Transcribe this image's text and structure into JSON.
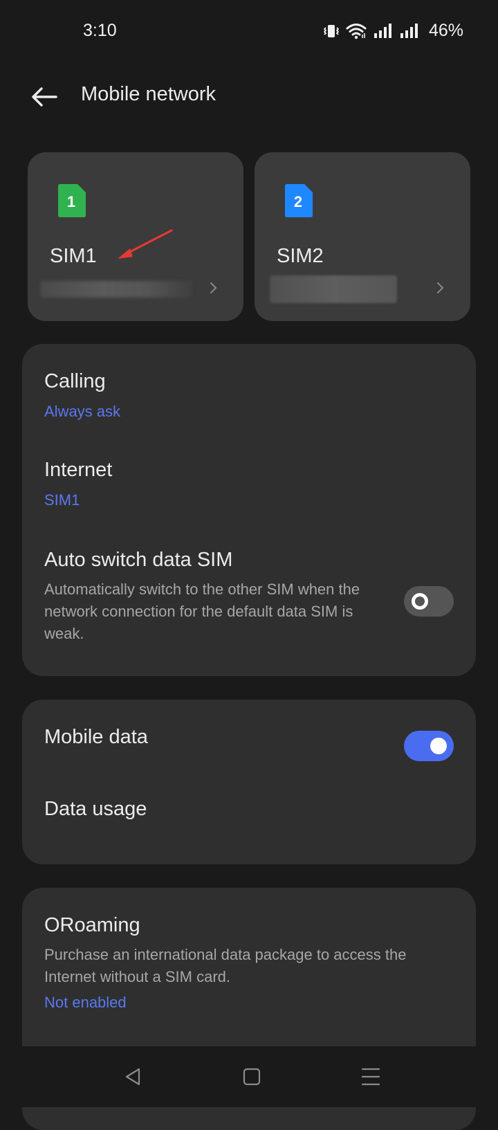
{
  "status_bar": {
    "time": "3:10",
    "battery": "46%",
    "icons": [
      "vibrate-icon",
      "wifi-icon",
      "signal-sim1-icon",
      "signal-sim2-icon"
    ]
  },
  "app_bar": {
    "title": "Mobile network",
    "back_icon": "back-arrow-icon"
  },
  "sim_cards": [
    {
      "badge": "1",
      "name": "SIM1",
      "badge_color": "#2fb24f"
    },
    {
      "badge": "2",
      "name": "SIM2",
      "badge_color": "#1e88ff"
    }
  ],
  "group1": {
    "calling": {
      "title": "Calling",
      "value": "Always ask"
    },
    "internet": {
      "title": "Internet",
      "value": "SIM1"
    },
    "auto_switch": {
      "title": "Auto switch data SIM",
      "description": "Automatically switch to the other SIM when the network connection for the default data SIM is weak.",
      "enabled": false
    }
  },
  "group2": {
    "mobile_data": {
      "title": "Mobile data",
      "enabled": true
    },
    "data_usage": {
      "title": "Data usage"
    }
  },
  "group3": {
    "oroaming": {
      "title": "ORoaming",
      "description": "Purchase an international data package to access the Internet without a SIM card.",
      "value": "Not enabled"
    }
  },
  "colors": {
    "background": "#1a1a1a",
    "card": "#2f2f2f",
    "sim_card": "#3b3b3b",
    "accent": "#4a6cf0",
    "link_text": "#5a78f2",
    "annotation_arrow": "#e53935"
  },
  "nav_bar": {
    "icons": [
      "nav-back-icon",
      "nav-home-icon",
      "nav-recents-icon"
    ]
  }
}
